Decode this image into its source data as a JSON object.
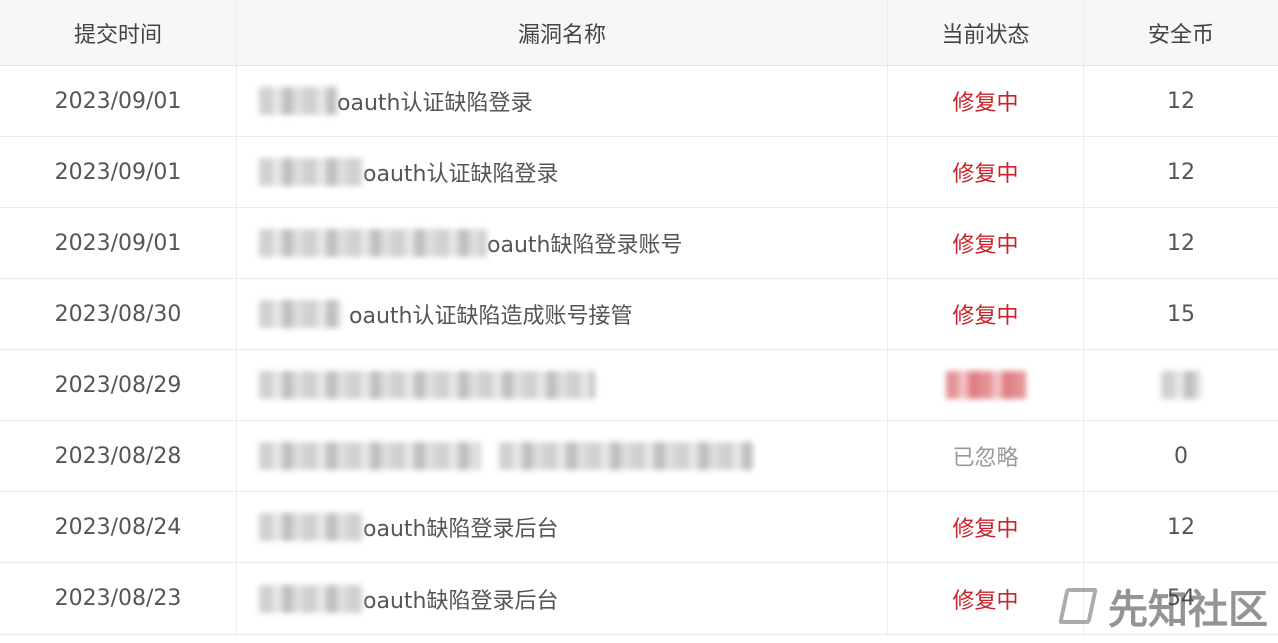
{
  "headers": {
    "date": "提交时间",
    "name": "漏洞名称",
    "status": "当前状态",
    "coins": "安全币"
  },
  "rows": [
    {
      "date": "2023/09/01",
      "name": "oauth认证缺陷登录",
      "status": "修复中",
      "coins": "12"
    },
    {
      "date": "2023/09/01",
      "name": "oauth认证缺陷登录",
      "status": "修复中",
      "coins": "12"
    },
    {
      "date": "2023/09/01",
      "name": "oauth缺陷登录账号",
      "status": "修复中",
      "coins": "12"
    },
    {
      "date": "2023/08/30",
      "name": "oauth认证缺陷造成账号接管",
      "status": "修复中",
      "coins": "15"
    },
    {
      "date": "2023/08/29",
      "name": "",
      "status": "",
      "coins": ""
    },
    {
      "date": "2023/08/28",
      "name": "",
      "status": "已忽略",
      "coins": "0"
    },
    {
      "date": "2023/08/24",
      "name": "oauth缺陷登录后台",
      "status": "修复中",
      "coins": "12"
    },
    {
      "date": "2023/08/23",
      "name": "oauth缺陷登录后台",
      "status": "修复中",
      "coins": "54"
    }
  ],
  "watermark": {
    "text": "先知社区",
    "icon": "xianzhi-logo-icon"
  },
  "colors": {
    "status_fixing": "#c8222a",
    "status_ignored": "#999999",
    "header_bg": "#f7f7f7"
  }
}
